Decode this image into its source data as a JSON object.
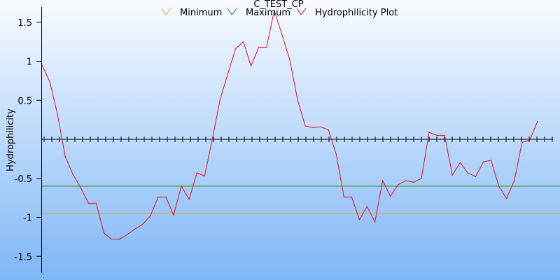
{
  "chart_data": {
    "type": "line",
    "title": "C_TEST_CP",
    "xlabel": "",
    "ylabel": "Hydrophilicity",
    "ylim": [
      -1.72,
      1.72
    ],
    "xlim": [
      0,
      66
    ],
    "yticks": [
      1.5,
      1,
      0.5,
      -0.5,
      -1,
      -1.5
    ],
    "ytick_labels": [
      "1.5",
      "1",
      "0.5",
      "-0.5",
      "-1",
      "-1.5"
    ],
    "grid": false,
    "legend_position": "top",
    "legend": [
      {
        "name": "Minimum",
        "color": "#f0a030"
      },
      {
        "name": "Maximum",
        "color": "#1a8a1a"
      },
      {
        "name": "Hydrophilicity Plot",
        "color": "#e01020"
      }
    ],
    "series": [
      {
        "name": "Minimum",
        "type": "hline",
        "value": -0.95,
        "color": "#f0a030"
      },
      {
        "name": "Maximum",
        "type": "hline",
        "value": -0.6,
        "color": "#1a8a1a"
      },
      {
        "name": "Hydrophilicity Plot",
        "color": "#e01020",
        "values": [
          0.95,
          0.74,
          0.32,
          -0.22,
          -0.45,
          -0.62,
          -0.82,
          -0.82,
          -1.2,
          -1.28,
          -1.28,
          -1.22,
          -1.15,
          -1.09,
          -0.98,
          -0.74,
          -0.74,
          -0.97,
          -0.6,
          -0.77,
          -0.43,
          -0.47,
          0.0,
          0.51,
          0.84,
          1.16,
          1.25,
          0.94,
          1.18,
          1.18,
          1.65,
          1.34,
          1.02,
          0.51,
          0.17,
          0.15,
          0.16,
          0.12,
          -0.19,
          -0.74,
          -0.74,
          -1.03,
          -0.86,
          -1.06,
          -0.53,
          -0.73,
          -0.58,
          -0.53,
          -0.55,
          -0.5,
          0.09,
          0.05,
          0.05,
          -0.46,
          -0.3,
          -0.43,
          -0.48,
          -0.29,
          -0.27,
          -0.6,
          -0.76,
          -0.53,
          -0.04,
          -0.01,
          0.23
        ]
      }
    ],
    "baseline": {
      "value": 0,
      "color": "#000000"
    }
  }
}
